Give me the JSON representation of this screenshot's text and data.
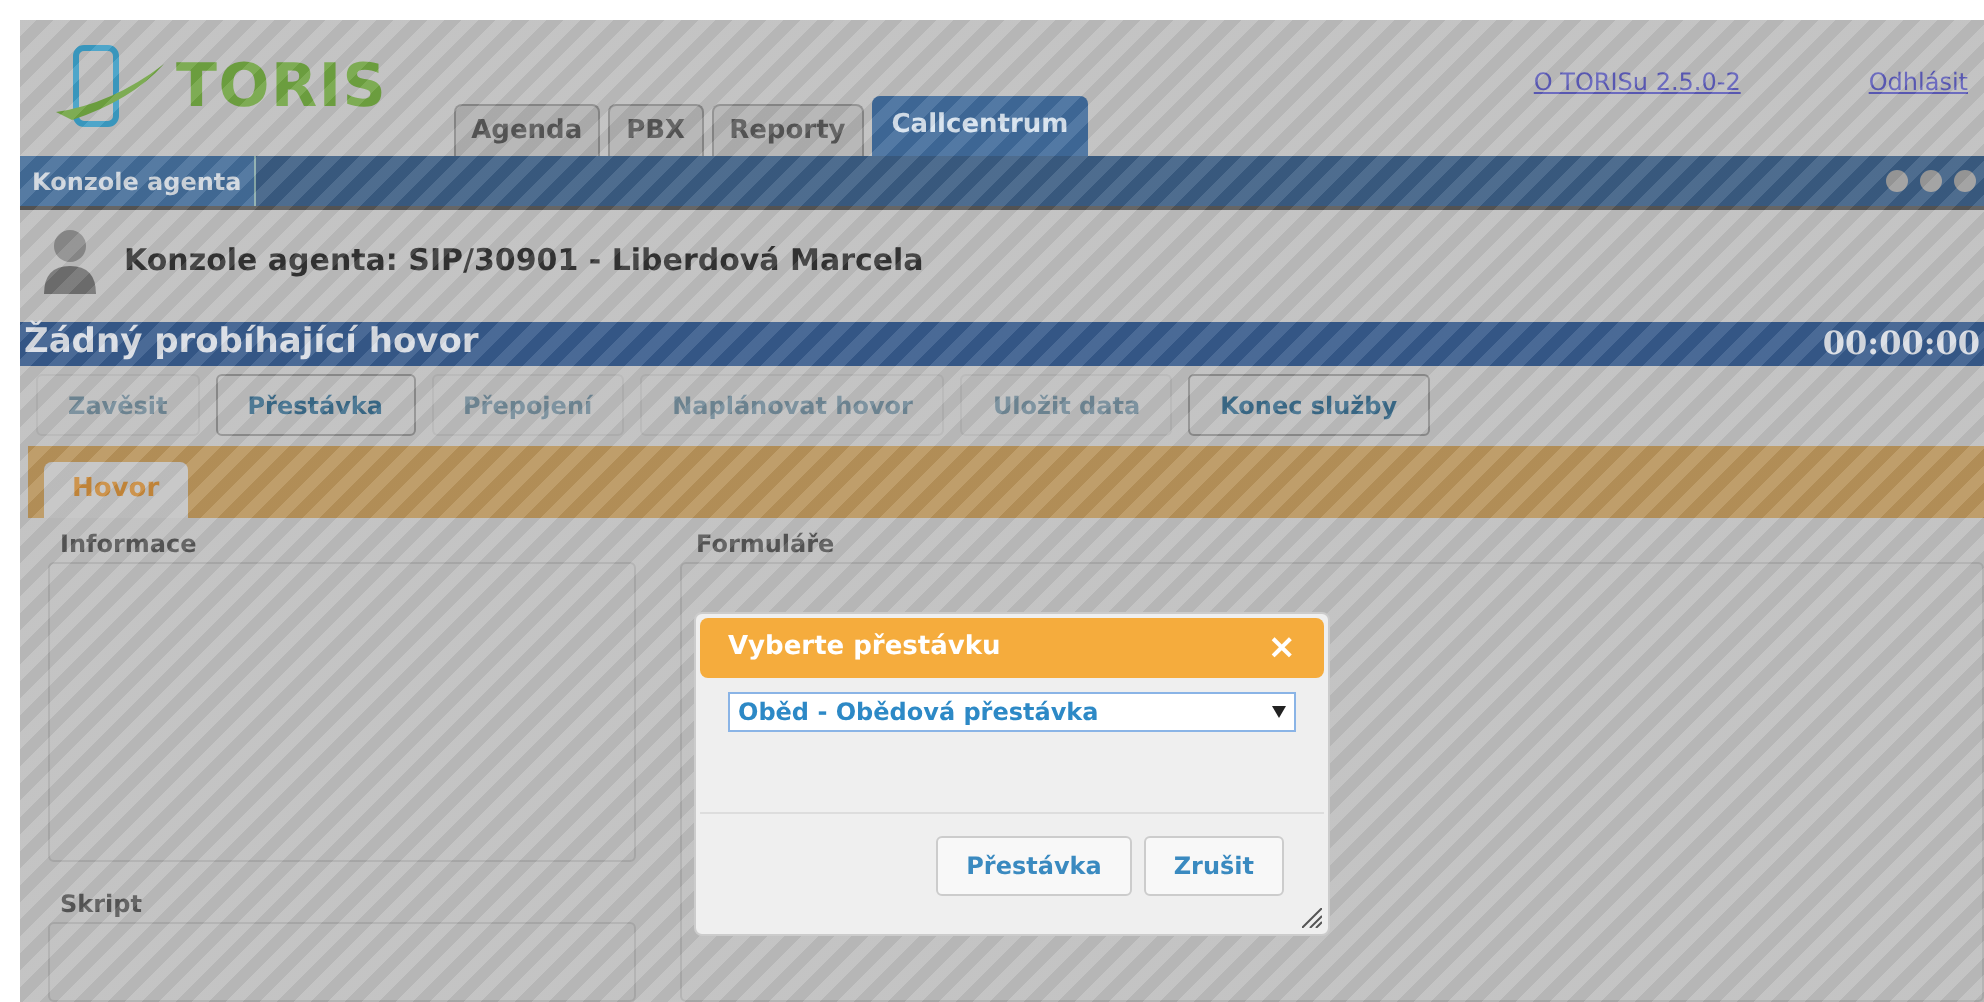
{
  "header": {
    "logo": "TORIS",
    "links": [
      "O TORISu 2.5.0-2",
      "Odhlásit"
    ]
  },
  "main_tabs": [
    {
      "label": "Agenda",
      "selected": false
    },
    {
      "label": "PBX",
      "selected": false
    },
    {
      "label": "Reporty",
      "selected": false
    },
    {
      "label": "Callcentrum",
      "selected": true
    }
  ],
  "sub_nav": {
    "items": [
      {
        "label": "Konzole agenta",
        "selected": true
      }
    ]
  },
  "agent_title": "Konzole agenta: SIP/30901 - Liberdová Marcela",
  "call_status": {
    "text": "Žádný probíhající hovor",
    "timer": "00:00:00"
  },
  "toolbar": [
    {
      "label": "Zavěsit",
      "disabled": true
    },
    {
      "label": "Přestávka",
      "disabled": false
    },
    {
      "label": "Přepojení",
      "disabled": true
    },
    {
      "label": "Naplánovat hovor",
      "disabled": true
    },
    {
      "label": "Uložit data",
      "disabled": true
    },
    {
      "label": "Konec služby",
      "disabled": false
    }
  ],
  "call_tabs": [
    {
      "label": "Hovor",
      "selected": true
    }
  ],
  "panels": {
    "left": [
      "Informace",
      "Skript"
    ],
    "right": "Formuláře"
  },
  "dialog": {
    "title": "Vyberte přestávku",
    "close": "×",
    "select_value": "Oběd - Obědová přestávka",
    "buttons": [
      "Přestávka",
      "Zrušit"
    ]
  }
}
